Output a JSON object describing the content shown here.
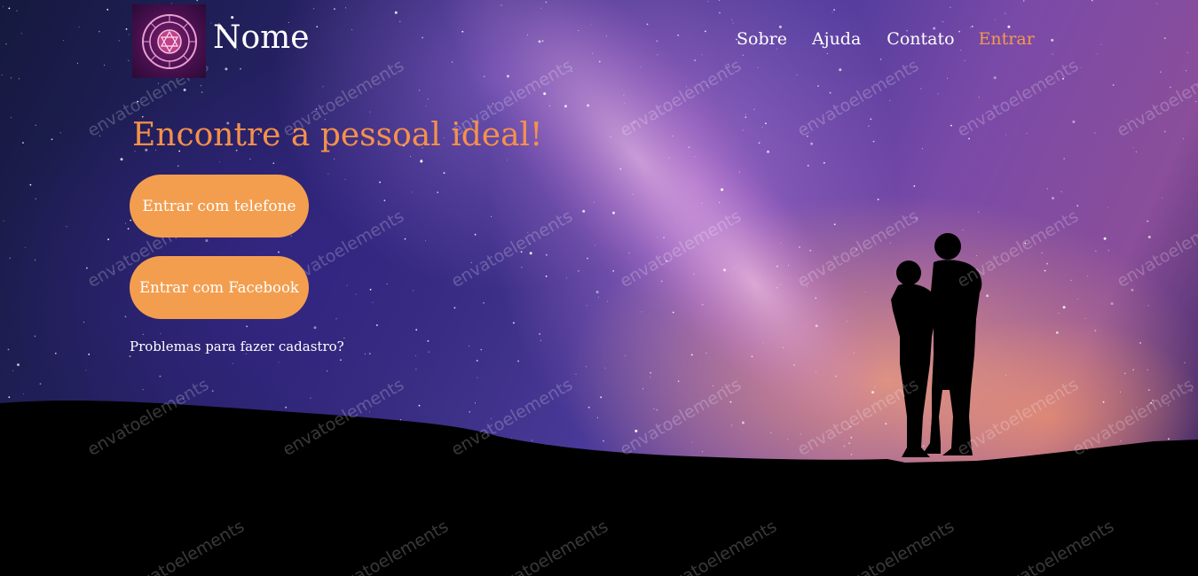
{
  "header": {
    "logo_icon": "zodiac-wheel-icon",
    "site_name": "Nome",
    "nav": [
      {
        "label": "Sobre"
      },
      {
        "label": "Ajuda"
      },
      {
        "label": "Contato"
      },
      {
        "label": "Entrar",
        "color": "#f59a4b"
      }
    ]
  },
  "hero": {
    "headline": "Encontre a pessoal ideal!",
    "buttons": {
      "phone": "Entrar com telefone",
      "facebook": "Entrar com Facebook"
    },
    "problems_link": "Problemas para fazer cadastro?"
  },
  "background": {
    "image": "starry-sky-couple-silhouette",
    "watermark_text": "envatoelements"
  },
  "colors": {
    "accent": "#f5914a",
    "button": "#f39e4f",
    "text": "#ffffff"
  }
}
